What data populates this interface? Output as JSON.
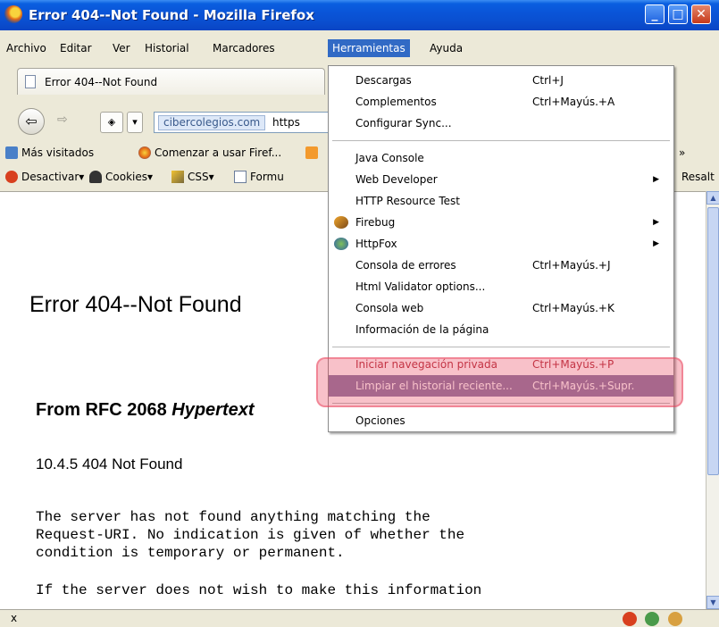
{
  "window": {
    "title": "Error 404--Not Found - Mozilla Firefox"
  },
  "menubar": [
    "Archivo",
    "Editar",
    "Ver",
    "Historial",
    "Marcadores",
    "Herramientas",
    "Ayuda"
  ],
  "tab": {
    "label": "Error 404--Not Found"
  },
  "urlbar": {
    "site": "cibercolegios.com",
    "rest": "https"
  },
  "bookmarks": [
    "Más visitados",
    "Comenzar a usar Firef...",
    "Resalt"
  ],
  "devbar": [
    "Desactivar▾",
    "Cookies▾",
    "CSS▾",
    "Formu"
  ],
  "content": {
    "heading": "Error 404--Not Found",
    "rfc_prefix": "From RFC 2068 ",
    "rfc_italic": "Hypertext",
    "subheading": "10.4.5 404 Not Found",
    "paragraph": "The server has not found anything matching the\nRequest-URI. No indication is given of whether the\ncondition is temporary or permanent.",
    "paragraph_cut": "If the server does not wish to make this information"
  },
  "dropdown": {
    "items": [
      {
        "label": "Descargas",
        "shortcut": "Ctrl+J"
      },
      {
        "label": "Complementos",
        "shortcut": "Ctrl+Mayús.+A"
      },
      {
        "label": "Configurar Sync...",
        "shortcut": ""
      },
      {
        "label": "Java Console",
        "shortcut": ""
      },
      {
        "label": "Web Developer",
        "shortcut": ""
      },
      {
        "label": "HTTP Resource Test",
        "shortcut": ""
      },
      {
        "label": "Firebug",
        "shortcut": ""
      },
      {
        "label": "HttpFox",
        "shortcut": ""
      },
      {
        "label": "Consola de errores",
        "shortcut": "Ctrl+Mayús.+J"
      },
      {
        "label": "Html Validator options...",
        "shortcut": ""
      },
      {
        "label": "Consola web",
        "shortcut": "Ctrl+Mayús.+K"
      },
      {
        "label": "Información de la página",
        "shortcut": ""
      },
      {
        "label": "Iniciar navegación privada",
        "shortcut": "Ctrl+Mayús.+P"
      },
      {
        "label": "Limpiar el historial reciente...",
        "shortcut": "Ctrl+Mayús.+Supr."
      },
      {
        "label": "Opciones",
        "shortcut": ""
      }
    ]
  },
  "statusbar": {
    "close": "x"
  },
  "colors": {
    "titlebar": "#0a55d8",
    "menu_highlight": "#316ac5",
    "highlight_box": "#e83f58",
    "item_hover": "#8a7ba6"
  }
}
